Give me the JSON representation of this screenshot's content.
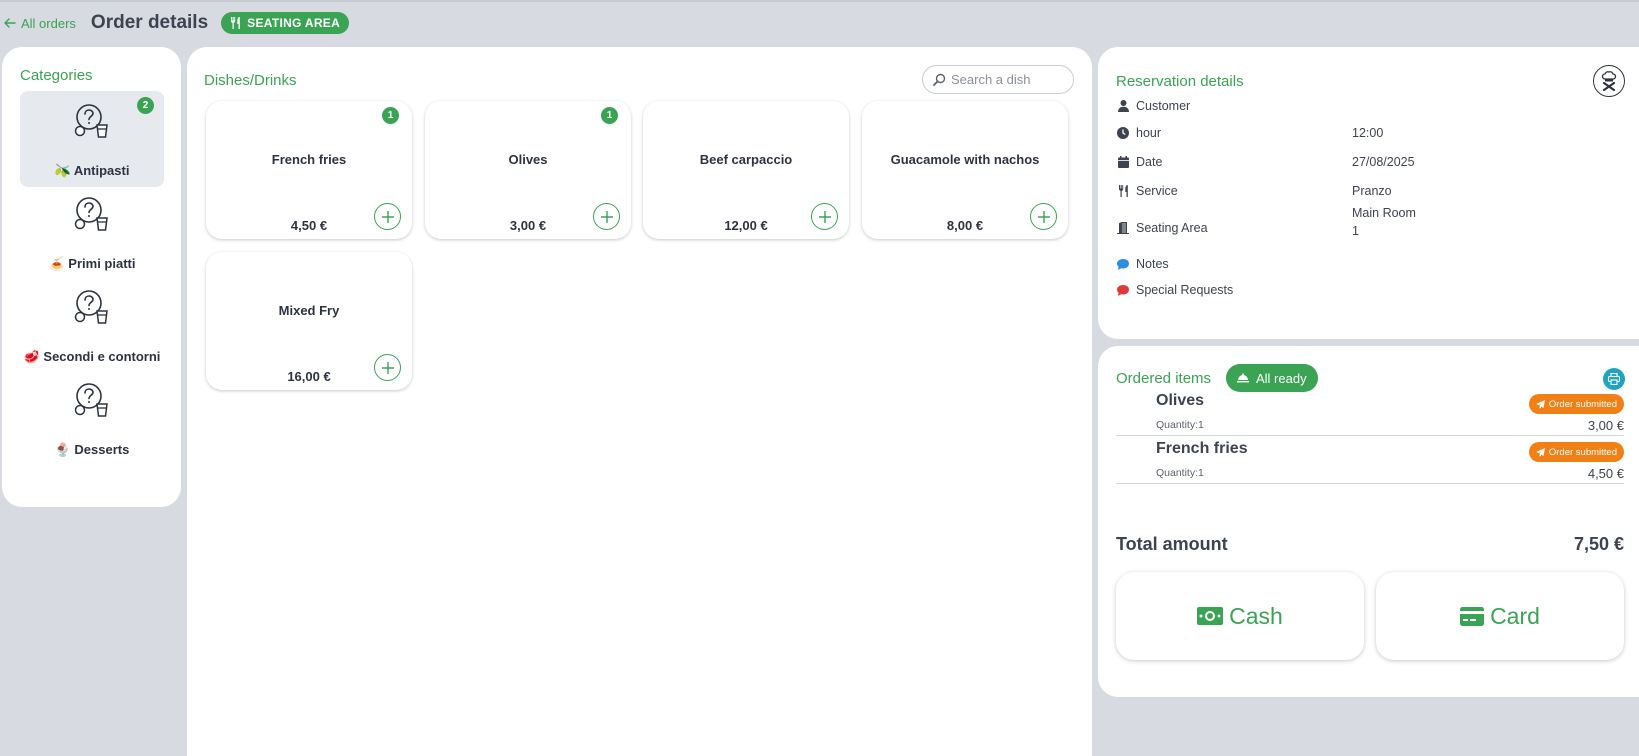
{
  "header": {
    "back_label": "All orders",
    "title": "Order details",
    "badge": "SEATING AREA"
  },
  "categories": {
    "title": "Categories",
    "items": [
      {
        "label": "🫒 Antipasti",
        "count": "2",
        "selected": true
      },
      {
        "label": "🍝 Primi piatti"
      },
      {
        "label": "🥩 Secondi e contorni"
      },
      {
        "label": "🍨 Desserts"
      }
    ]
  },
  "dishes": {
    "title": "Dishes/Drinks",
    "search_placeholder": "Search a dish",
    "items": [
      {
        "name": "French fries",
        "price": "4,50 €",
        "qty": "1"
      },
      {
        "name": "Olives",
        "price": "3,00 €",
        "qty": "1"
      },
      {
        "name": "Beef carpaccio",
        "price": "12,00 €"
      },
      {
        "name": "Guacamole with nachos",
        "price": "8,00 €"
      },
      {
        "name": "Mixed Fry",
        "price": "16,00 €"
      }
    ]
  },
  "reservation": {
    "title": "Reservation details",
    "rows": [
      {
        "icon": "user-icon",
        "label": "Customer",
        "value": ""
      },
      {
        "icon": "clock-icon",
        "label": "hour",
        "value": "12:00"
      },
      {
        "icon": "calendar-icon",
        "label": "Date",
        "value": "27/08/2025"
      },
      {
        "icon": "utensils-icon",
        "label": "Service",
        "value": "Pranzo"
      },
      {
        "icon": "door-icon",
        "label": "Seating Area",
        "value": "Main Room",
        "value2": "1"
      },
      {
        "icon": "comment-icon",
        "label": "Notes",
        "value": "",
        "color": "#2b8fe0"
      },
      {
        "icon": "comment-icon",
        "label": "Special Requests",
        "value": "",
        "color": "#e03b3b"
      }
    ]
  },
  "ordered": {
    "title": "Ordered items",
    "ready_label": "All ready",
    "items": [
      {
        "name": "Olives",
        "quantity": "Quantity:1",
        "status": "Order submitted",
        "price": "3,00 €"
      },
      {
        "name": "French fries",
        "quantity": "Quantity:1",
        "status": "Order submitted",
        "price": "4,50 €"
      }
    ],
    "total_label": "Total amount",
    "total_value": "7,50 €",
    "cash_label": "Cash",
    "card_label": "Card"
  },
  "colors": {
    "accent": "#3aa354",
    "status_orange": "#f07f16",
    "print_blue": "#1fa3c1",
    "background": "#d7dae1"
  }
}
